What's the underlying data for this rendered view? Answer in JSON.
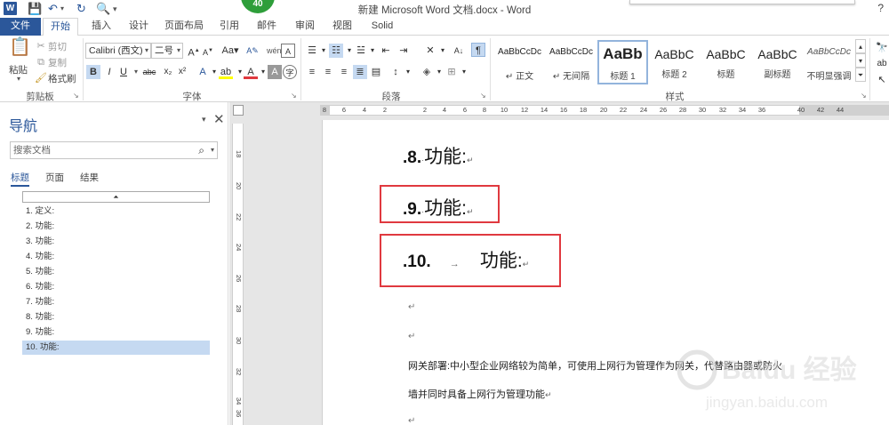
{
  "titlebar": {
    "title": "新建 Microsoft Word 文档.docx - Word",
    "badge": "40",
    "help": "?"
  },
  "ribbon_tabs": [
    "文件",
    "开始",
    "插入",
    "设计",
    "页面布局",
    "引用",
    "邮件",
    "审阅",
    "视图",
    "Solid"
  ],
  "clipboard": {
    "paste": "粘贴",
    "cut": "剪切",
    "copy": "复制",
    "format_painter": "格式刷",
    "group": "剪贴板"
  },
  "font": {
    "name": "Calibri (西文)",
    "size": "二号",
    "group": "字体"
  },
  "paragraph": {
    "group": "段落"
  },
  "styles": {
    "group": "样式",
    "items": [
      {
        "sample": "AaBbCcDc",
        "name": "↵ 正文"
      },
      {
        "sample": "AaBbCcDc",
        "name": "↵ 无间隔"
      },
      {
        "sample": "AaBb",
        "name": "标题 1"
      },
      {
        "sample": "AaBbC",
        "name": "标题 2"
      },
      {
        "sample": "AaBbC",
        "name": "标题"
      },
      {
        "sample": "AaBbC",
        "name": "副标题"
      },
      {
        "sample": "AaBbCcDc",
        "name": "不明显强调"
      }
    ]
  },
  "nav": {
    "title": "导航",
    "search_placeholder": "搜索文档",
    "tabs": [
      "标题",
      "页面",
      "结果"
    ],
    "headings": [
      "1. 定义:",
      "2. 功能:",
      "3. 功能:",
      "4. 功能:",
      "5. 功能:",
      "6. 功能:",
      "7. 功能:",
      "8. 功能:",
      "9. 功能:",
      "10. 功能:"
    ],
    "selected_index": 9
  },
  "ruler": {
    "h": [
      "8",
      "6",
      "4",
      "2",
      "2",
      "4",
      "6",
      "8",
      "10",
      "12",
      "14",
      "16",
      "18",
      "20",
      "22",
      "24",
      "26",
      "28",
      "30",
      "32",
      "34",
      "36",
      "40",
      "42",
      "44"
    ],
    "v": [
      "18",
      "20",
      "22",
      "24",
      "26",
      "28",
      "30",
      "32",
      "34",
      "36"
    ]
  },
  "document": {
    "h8_num": ".8.",
    "h8_text": "功能:",
    "h9_num": ".9.",
    "h9_text": "功能:",
    "h10_num": ".10.",
    "h10_text": "功能:",
    "tab_mark": "→",
    "return_mark": "↵",
    "body_line1": "网关部署:中小型企业网络较为简单，可使用上网行为管理作为网关，代替路由器或防火",
    "body_line2": "墙并同时具备上网行为管理功能"
  },
  "watermark": {
    "brand": "Baidu 经验",
    "url": "jingyan.baidu.com"
  },
  "colors": {
    "accent": "#2b579a",
    "highlight_box": "#e0393f",
    "nav_selected": "#c5d9f1"
  }
}
